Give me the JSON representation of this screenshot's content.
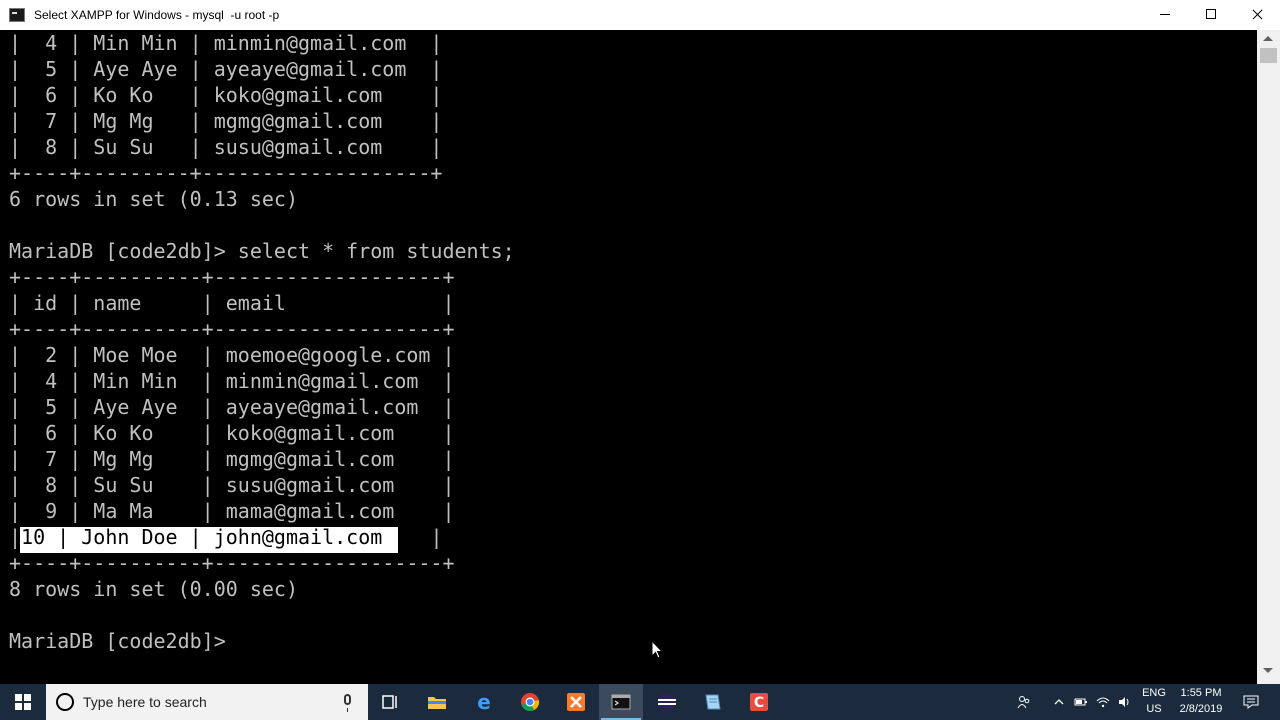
{
  "window": {
    "title": "Select XAMPP for Windows - mysql  -u root -p"
  },
  "console": {
    "lines": [
      "|  4 | Min Min | minmin@gmail.com  |",
      "|  5 | Aye Aye | ayeaye@gmail.com  |",
      "|  6 | Ko Ko   | koko@gmail.com    |",
      "|  7 | Mg Mg   | mgmg@gmail.com    |",
      "|  8 | Su Su   | susu@gmail.com    |",
      "+----+---------+-------------------+",
      "6 rows in set (0.13 sec)",
      "",
      "MariaDB [code2db]> select * from students;",
      "+----+----------+-------------------+",
      "| id | name     | email             |",
      "+----+----------+-------------------+",
      "|  2 | Moe Moe  | moemoe@google.com |",
      "|  4 | Min Min  | minmin@gmail.com  |",
      "|  5 | Aye Aye  | ayeaye@gmail.com  |",
      "|  6 | Ko Ko    | koko@gmail.com    |",
      "|  7 | Mg Mg    | mgmg@gmail.com    |",
      "|  8 | Su Su    | susu@gmail.com    |",
      "|  9 | Ma Ma    | mama@gmail.com    |",
      "| 10 | John Doe | john@gmail.com    |",
      "+----+----------+-------------------+",
      "8 rows in set (0.00 sec)",
      "",
      "MariaDB [code2db]>"
    ],
    "selected_text": "10 | John Doe | john@gmail.com"
  },
  "taskbar": {
    "search_placeholder": "Type here to search",
    "language_top": "ENG",
    "language_bottom": "US",
    "time": "1:55 PM",
    "date": "2/8/2019"
  },
  "colors": {
    "console_bg": "#000000",
    "console_text": "#c0c0c0",
    "taskbar_bg": "#1b2a3c"
  }
}
